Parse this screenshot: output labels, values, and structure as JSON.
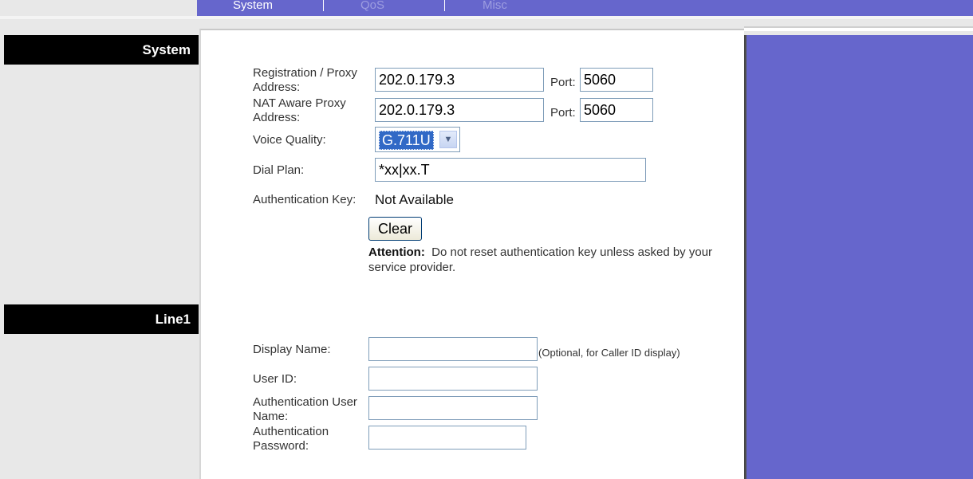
{
  "nav": {
    "tabs": [
      {
        "label": "System"
      },
      {
        "label": "QoS"
      },
      {
        "label": "Misc"
      }
    ]
  },
  "sections": {
    "system_label": "System",
    "line1_label": "Line1"
  },
  "system": {
    "registration_label": "Registration / Proxy Address:",
    "registration_value": "202.0.179.3",
    "registration_port_label": "Port:",
    "registration_port_value": "5060",
    "nat_label": "NAT Aware Proxy Address:",
    "nat_value": "202.0.179.3",
    "nat_port_label": "Port:",
    "nat_port_value": "5060",
    "voice_quality_label": "Voice Quality:",
    "voice_quality_value": "G.711U",
    "dial_plan_label": "Dial Plan:",
    "dial_plan_value": "*xx|xx.T",
    "auth_key_label": "Authentication Key:",
    "auth_key_value": "Not Available",
    "clear_button": "Clear",
    "attention_label": "Attention:",
    "attention_text": "Do not reset authentication key unless asked by your service provider."
  },
  "line1": {
    "display_name_label": "Display Name:",
    "display_name_value": "",
    "display_name_hint": "(Optional, for Caller ID display)",
    "user_id_label": "User ID:",
    "user_id_value": "",
    "auth_user_label": "Authentication User Name:",
    "auth_user_value": "",
    "auth_password_label": "Authentication Password:",
    "auth_password_value": ""
  },
  "colors": {
    "accent": "#6666cc",
    "header_bg": "#000000",
    "page_bg": "#e8e8e8"
  }
}
